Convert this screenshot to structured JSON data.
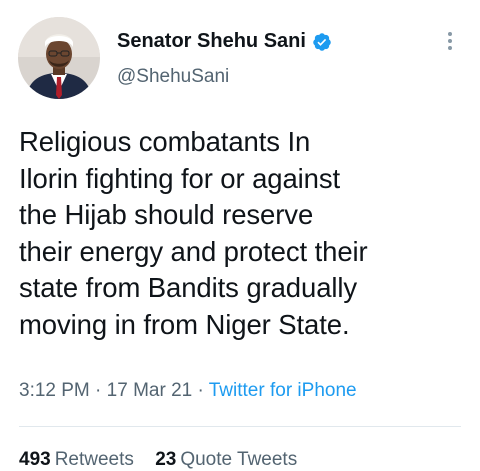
{
  "author": {
    "display_name": "Senator Shehu Sani",
    "handle": "@ShehuSani",
    "verified_icon": "verified-badge-icon",
    "avatar_icon": "profile-photo"
  },
  "menu": {
    "icon": "more-vertical-icon"
  },
  "tweet": {
    "text": "Religious combatants In\nIlorin fighting for or against\nthe Hijab should reserve\ntheir energy and protect their\nstate from Bandits gradually\nmoving in from Niger State.",
    "time": "3:12 PM",
    "date": "17 Mar 21",
    "separator": "·",
    "source": "Twitter for iPhone"
  },
  "stats": {
    "retweets_count": "493",
    "retweets_label": "Retweets",
    "quotes_count": "23",
    "quotes_label": "Quote Tweets"
  },
  "colors": {
    "link": "#1d9bf0",
    "secondary_text": "#536471",
    "primary_text": "#0f1419",
    "divider": "#e1e8ed"
  }
}
